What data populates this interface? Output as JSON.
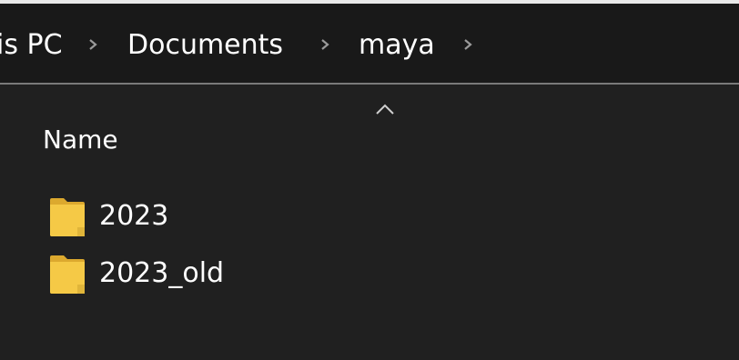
{
  "address_bar": {
    "breadcrumbs": [
      "is PC",
      "Documents",
      "maya"
    ]
  },
  "file_list": {
    "column_header": "Name",
    "sort_direction": "ascending",
    "items": [
      {
        "name": "2023",
        "type": "folder"
      },
      {
        "name": "2023_old",
        "type": "folder"
      }
    ]
  },
  "colors": {
    "background": "#202020",
    "address_bar_bg": "#191919",
    "folder_yellow": "#f5c946",
    "text": "#ffffff",
    "chevron": "#9a9a9a"
  }
}
